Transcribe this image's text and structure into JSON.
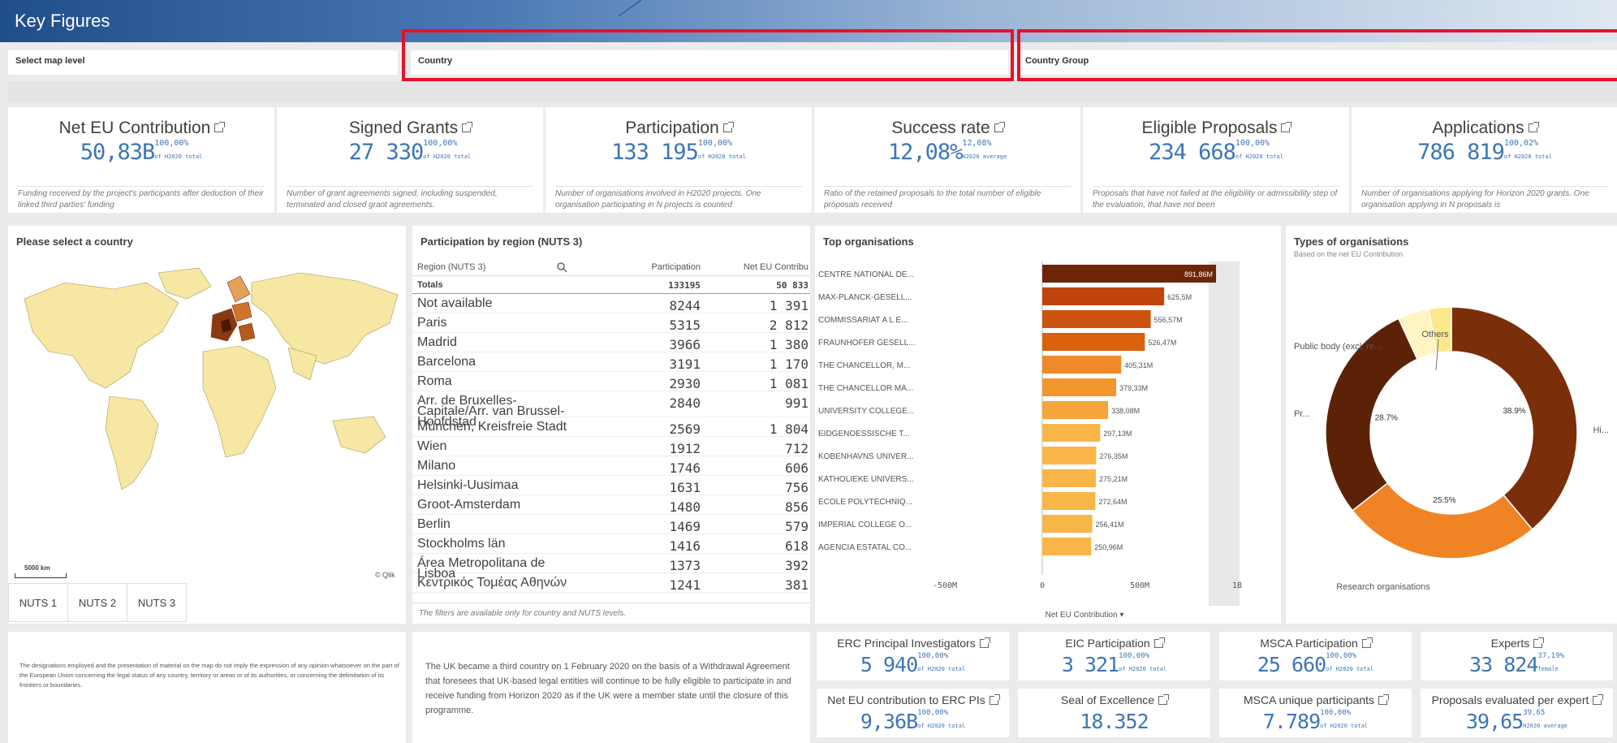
{
  "header": {
    "title": "Key Figures"
  },
  "filters": [
    {
      "label": "Select map level"
    },
    {
      "label": "Country"
    },
    {
      "label": "Country Group"
    }
  ],
  "kpis": [
    {
      "title": "Net EU Contribution",
      "value": "50,83B",
      "pct": "100,00%",
      "sub": "of H2020 total",
      "desc": "Funding received by the project's participants after deduction of their linked third parties' funding"
    },
    {
      "title": "Signed Grants",
      "value": "27 330",
      "pct": "100,00%",
      "sub": "of H2020 total",
      "desc": "Number of grant agreements signed, including suspended, terminated and closed grant agreements."
    },
    {
      "title": "Participation",
      "value": "133 195",
      "pct": "100,00%",
      "sub": "of H2020 total",
      "desc": "Number of organisations involved in H2020 projects. One organisation participating in N projects is counted"
    },
    {
      "title": "Success rate",
      "value": "12,08%",
      "pct": "12,08%",
      "sub": "H2020 average",
      "desc": "Ratio of the retained proposals to the total number of eligible proposals received"
    },
    {
      "title": "Eligible Proposals",
      "value": "234 668",
      "pct": "100,00%",
      "sub": "of H2020 total",
      "desc": "Proposals that have not failed at the eligibility or admissibility step of the evaluation, that have not been"
    },
    {
      "title": "Applications",
      "value": "786 819",
      "pct": "100,02%",
      "sub": "of H2020 total",
      "desc": "Number of organisations applying for Horizon 2020 grants. One organisation applying in N proposals is"
    }
  ],
  "map": {
    "title": "Please select a country",
    "scale": "5000 km",
    "credit": "© Qlik",
    "levels": [
      "NUTS 1",
      "NUTS 2",
      "NUTS 3"
    ]
  },
  "regions": {
    "title": "Participation by region (NUTS 3)",
    "col_region": "Region (NUTS 3)",
    "col_part": "Participation",
    "col_net": "Net EU Contribu",
    "totals": {
      "label": "Totals",
      "part": "133195",
      "net": "50 833"
    },
    "rows": [
      {
        "r": "Not available",
        "p": "8244",
        "n": "1 391"
      },
      {
        "r": "Paris",
        "p": "5315",
        "n": "2 812"
      },
      {
        "r": "Madrid",
        "p": "3966",
        "n": "1 380"
      },
      {
        "r": "Barcelona",
        "p": "3191",
        "n": "1 170"
      },
      {
        "r": "Roma",
        "p": "2930",
        "n": "1 081"
      },
      {
        "r": "Arr. de Bruxelles-Capitale/Arr. van Brussel-Hoofdstad",
        "p": "2840",
        "n": "991"
      },
      {
        "r": "München, Kreisfreie Stadt",
        "p": "2569",
        "n": "1 804"
      },
      {
        "r": "Wien",
        "p": "1912",
        "n": "712"
      },
      {
        "r": "Milano",
        "p": "1746",
        "n": "606"
      },
      {
        "r": "Helsinki-Uusimaa",
        "p": "1631",
        "n": "756"
      },
      {
        "r": "Groot-Amsterdam",
        "p": "1480",
        "n": "856"
      },
      {
        "r": "Berlin",
        "p": "1469",
        "n": "579"
      },
      {
        "r": "Stockholms län",
        "p": "1416",
        "n": "618"
      },
      {
        "r": "Área Metropolitana de Lisboa",
        "p": "1373",
        "n": "392"
      },
      {
        "r": "Κεντρικός Τομέας Αθηνών",
        "p": "1241",
        "n": "381"
      }
    ],
    "footnote": "The filters are available only for country and NUTS levels."
  },
  "chart_data": [
    {
      "type": "bar",
      "title": "Top organisations",
      "categories": [
        "CENTRE NATIONAL DE...",
        "MAX-PLANCK-GESELL...",
        "COMMISSARIAT A L E...",
        "FRAUNHOFER GESELL...",
        "THE CHANCELLOR, M...",
        "THE CHANCELLOR MA...",
        "UNIVERSITY COLLEGE...",
        "EIDGENOESSISCHE T...",
        "KOBENHAVNS UNIVER...",
        "KATHOLIEKE UNIVERS...",
        "ECOLE POLYTECHNIQ...",
        "IMPERIAL COLLEGE O...",
        "AGENCIA ESTATAL CO..."
      ],
      "values": [
        891.86,
        625.5,
        556.57,
        526.47,
        405.31,
        379.33,
        338.08,
        297.13,
        276.35,
        275.21,
        272.64,
        256.41,
        250.96
      ],
      "value_labels": [
        "891,86M",
        "625,5M",
        "556,57M",
        "526,47M",
        "405,31M",
        "379,33M",
        "338,08M",
        "297,13M",
        "276,35M",
        "275,21M",
        "272,64M",
        "256,41M",
        "250,96M"
      ],
      "colors": [
        "#6b2507",
        "#c1440e",
        "#cc520f",
        "#d9620f",
        "#ee8a2a",
        "#f2962e",
        "#f5a53a",
        "#f8b648",
        "#f8b648",
        "#f8b648",
        "#f8b648",
        "#f8b648",
        "#f8b648"
      ],
      "xlabel": "Net EU Contribution",
      "xlim": [
        -500,
        1000
      ],
      "ticks": [
        "-500M",
        "0",
        "500M",
        "1B"
      ]
    },
    {
      "type": "pie",
      "title": "Types of organisations",
      "subtitle": "Based on the net EU Contribution",
      "labels": [
        "Hi...",
        "Research organisations",
        "Pr...",
        "Public body (excl. re...",
        "Others"
      ],
      "values": [
        38.9,
        25.5,
        28.7,
        4.0,
        2.9
      ],
      "value_labels": [
        "38.9%",
        "25.5%",
        "28.7%",
        "",
        ""
      ],
      "colors": [
        "#7a2e0a",
        "#f08424",
        "#5c2208",
        "#fff4c2",
        "#fde88c"
      ]
    }
  ],
  "notes": {
    "map_disclaimer": "The designations employed and the presentation of material on the map do not imply the expression of any opinion whatsoever on the part of the European Union concerning the legal status of any country, territory or areas or of its authorities, or concerning the delimitation of its frontiers or boundaries.",
    "uk_note": "The UK became a third country on 1 February 2020 on the basis of a Withdrawal Agreement that foresees that UK-based legal entities will continue to be fully eligible to participate in and receive funding from Horizon 2020 as if the UK were a member state until the closure of this programme."
  },
  "bottom_kpis": [
    {
      "title": "ERC Principal Investigators",
      "value": "5 940",
      "pct": "100,00%",
      "sub": "of H2020 total"
    },
    {
      "title": "EIC Participation",
      "value": "3 321",
      "pct": "100,00%",
      "sub": "of H2020 total"
    },
    {
      "title": "MSCA Participation",
      "value": "25 660",
      "pct": "100,00%",
      "sub": "of H2020 total"
    },
    {
      "title": "Experts",
      "value": "33 824",
      "pct": "37,19%",
      "sub": "female"
    },
    {
      "title": "Net EU contribution to ERC PIs",
      "value": "9,36B",
      "pct": "100,00%",
      "sub": "of H2020 total"
    },
    {
      "title": "Seal of Excellence",
      "value": "18.352",
      "pct": "",
      "sub": ""
    },
    {
      "title": "MSCA unique participants",
      "value": "7.789",
      "pct": "100,00%",
      "sub": "of H2020 total"
    },
    {
      "title": "Proposals evaluated per expert",
      "value": "39,65",
      "pct": "39,65",
      "sub": "H2020 average"
    }
  ]
}
